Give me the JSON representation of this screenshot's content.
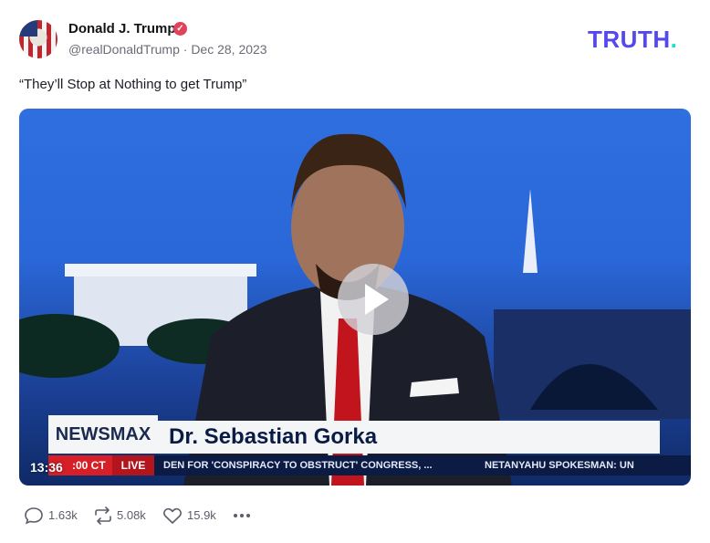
{
  "author": {
    "name": "Donald J. Trump",
    "handle": "@realDonaldTrump",
    "date": "Dec 28, 2023",
    "meta_separator": "·"
  },
  "brand": {
    "text": "TRUTH",
    "dot": "."
  },
  "post": {
    "text": "“They’ll Stop at Nothing to get Trump”"
  },
  "video": {
    "duration": "13:36",
    "chyron": {
      "network": "NEWSMAX",
      "guest": "Dr. Sebastian Gorka",
      "time": ":00 CT",
      "live": "LIVE",
      "ticker": "DEN FOR 'CONSPIRACY TO OBSTRUCT' CONGRESS, ...",
      "ticker2": "NETANYAHU SPOKESMAN: UN"
    }
  },
  "actions": {
    "replies": "1.63k",
    "retruths": "5.08k",
    "likes": "15.9k"
  },
  "colors": {
    "brand": "#5448ee",
    "brand_dot": "#17e2c3",
    "verified": "#e0445a",
    "muted_text": "#6b6b78"
  },
  "icons": {
    "reply": "speech-bubble-icon",
    "retruth": "repost-arrows-icon",
    "like": "heart-icon",
    "more": "more-dots-icon",
    "play": "play-icon",
    "verified": "verified-badge-icon"
  }
}
